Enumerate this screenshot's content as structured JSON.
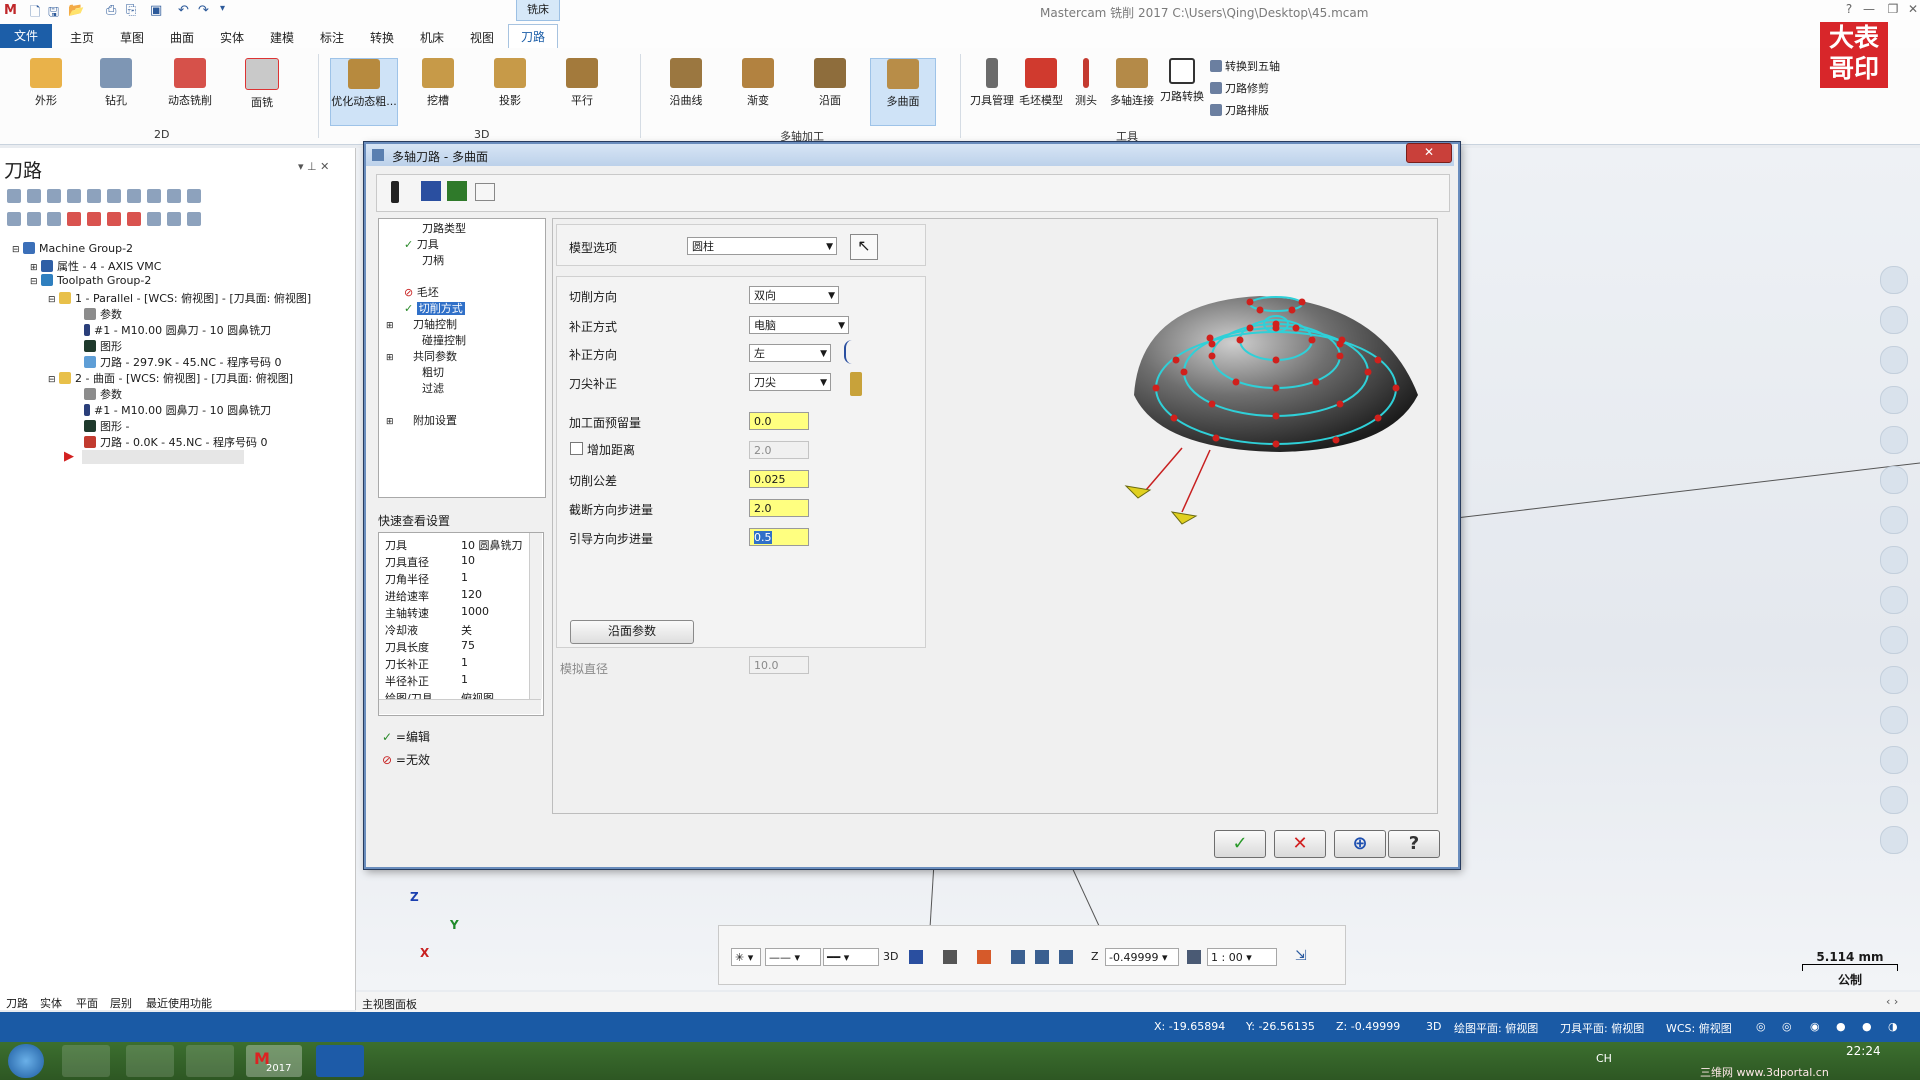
{
  "window": {
    "title": "Mastercam 铣削 2017  C:\\Users\\Qing\\Desktop\\45.mcam",
    "context_tab": "铣床"
  },
  "menu": {
    "file": "文件",
    "items": [
      "主页",
      "草图",
      "曲面",
      "实体",
      "建模",
      "标注",
      "转换",
      "机床",
      "视图"
    ],
    "active": "刀路"
  },
  "ribbon": {
    "group_2d": {
      "label": "2D",
      "buttons": [
        "外形",
        "钻孔",
        "动态铣削",
        "面铣"
      ]
    },
    "group_3d": {
      "label": "3D",
      "buttons": [
        "优化动态粗...",
        "挖槽",
        "投影",
        "平行"
      ]
    },
    "group_multi": {
      "label": "多轴加工",
      "buttons": [
        "沿曲线",
        "渐变",
        "沿面",
        "多曲面"
      ]
    },
    "group_tools": {
      "label": "工具",
      "buttons": [
        "刀具管理",
        "毛坯模型",
        "测头",
        "多轴连接",
        "刀路转换"
      ],
      "small": [
        "转换到五轴",
        "刀路修剪",
        "刀路排版"
      ]
    }
  },
  "logo": {
    "line1": "大表",
    "line2": "哥印"
  },
  "left_panel": {
    "title": "刀路",
    "tree": [
      "Machine Group-2",
      "属性 - 4 - AXIS VMC",
      "Toolpath Group-2",
      "1 - Parallel - [WCS: 俯视图] - [刀具面: 俯视图]",
      "参数",
      "#1 - M10.00 圆鼻刀 - 10 圆鼻铣刀",
      "图形",
      "刀路 - 297.9K - 45.NC - 程序号码 0",
      "2 - 曲面 - [WCS: 俯视图] - [刀具面: 俯视图]",
      "参数",
      "#1 - M10.00 圆鼻刀 - 10 圆鼻铣刀",
      "图形 -",
      "刀路 - 0.0K - 45.NC - 程序号码 0"
    ],
    "bottom_tabs": [
      "刀路",
      "实体",
      "平面",
      "层别",
      "最近使用功能"
    ]
  },
  "dialog": {
    "title": "多轴刀路 - 多曲面",
    "close": "✕",
    "nav": [
      "刀路类型",
      "刀具",
      "刀柄",
      "毛坯",
      "切削方式",
      "刀轴控制",
      "碰撞控制",
      "共同参数",
      "粗切",
      "过滤",
      "附加设置"
    ],
    "quick_title": "快速查看设置",
    "quick": [
      {
        "k": "刀具",
        "v": "10 圆鼻铣刀"
      },
      {
        "k": "刀具直径",
        "v": "10"
      },
      {
        "k": "刀角半径",
        "v": "1"
      },
      {
        "k": "进给速率",
        "v": "120"
      },
      {
        "k": "主轴转速",
        "v": "1000"
      },
      {
        "k": "冷却液",
        "v": "关"
      },
      {
        "k": "刀具长度",
        "v": "75"
      },
      {
        "k": "刀长补正",
        "v": "1"
      },
      {
        "k": "半径补正",
        "v": "1"
      },
      {
        "k": "绘图/刀具",
        "v": "俯视图"
      }
    ],
    "legend_edit": "=编辑",
    "legend_invalid": "=无效",
    "model_option_label": "模型选项",
    "model_option_value": "圆柱",
    "cut_dir_label": "切削方向",
    "cut_dir_value": "双向",
    "comp_type_label": "补正方式",
    "comp_type_value": "电脑",
    "comp_dir_label": "补正方向",
    "comp_dir_value": "左",
    "tip_comp_label": "刀尖补正",
    "tip_comp_value": "刀尖",
    "stock_label": "加工面预留量",
    "stock_value": "0.0",
    "add_dist_label": "增加距离",
    "add_dist_value": "2.0",
    "tolerance_label": "切削公差",
    "tolerance_value": "0.025",
    "cross_step_label": "截断方向步进量",
    "cross_step_value": "2.0",
    "lead_step_label": "引导方向步进量",
    "lead_step_value": "0.5",
    "flow_params_btn": "沿面参数",
    "sim_dia_label": "模拟直径",
    "sim_dia_value": "10.0"
  },
  "bottom_toolbar": {
    "mode": "3D",
    "z_label": "Z",
    "z_value": "-0.49999",
    "scale": "1 : 00"
  },
  "axes": {
    "z": "Z",
    "y": "Y",
    "x": "X"
  },
  "scale_bar": {
    "value": "5.114 mm",
    "unit": "公制"
  },
  "view_tab": "主视图面板",
  "status": {
    "x": "X:  -19.65894",
    "y": "Y:  -26.56135",
    "z": "Z:  -0.49999",
    "mode": "3D",
    "draw_plane": "绘图平面: 俯视图",
    "tool_plane": "刀具平面: 俯视图",
    "wcs": "WCS: 俯视图"
  },
  "taskbar": {
    "time": "22:24",
    "watermark": "三维网 www.3dportal.cn",
    "lang": "CH",
    "app_label": "2017"
  },
  "colors": {
    "accent": "#1c5ea8",
    "status": "#1a5aa5",
    "yellow_field": "#ffff80",
    "logo_red": "#d8262a"
  }
}
